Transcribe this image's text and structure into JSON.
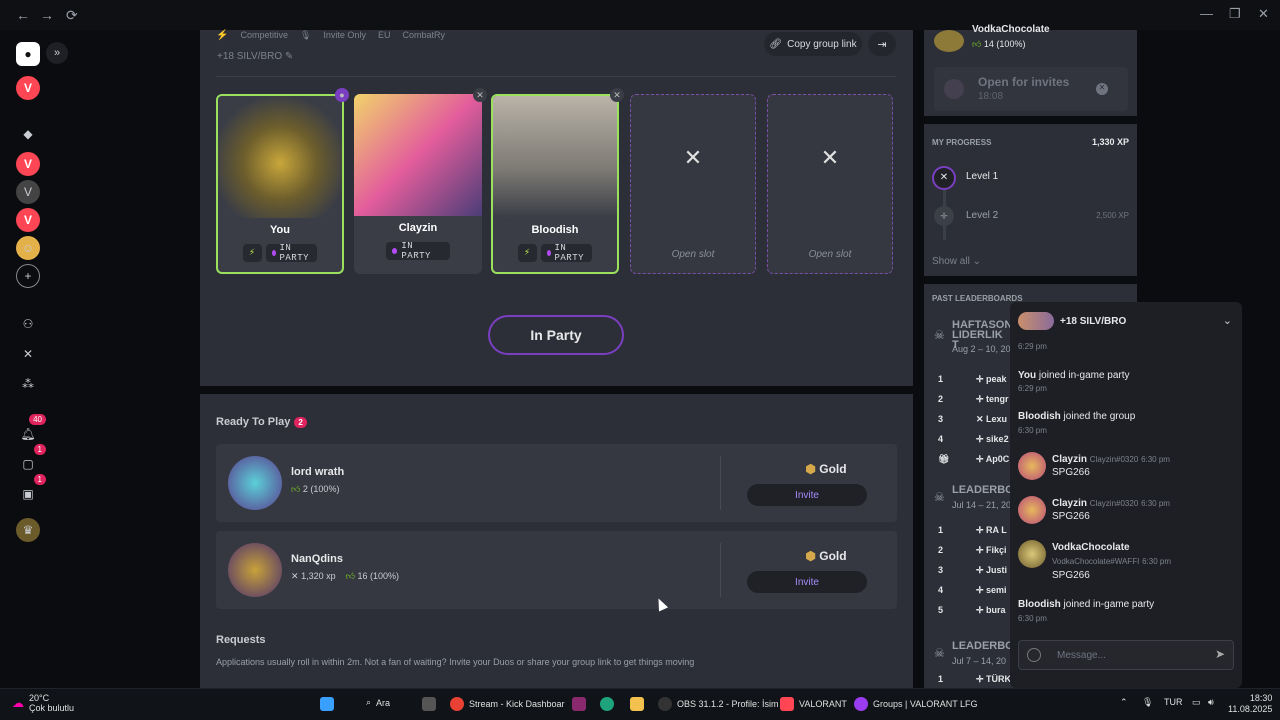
{
  "tags": [
    "Competitive",
    "Invite Only",
    "EU",
    "CombatRy"
  ],
  "group_name": "+18 SILV/BRO",
  "copy_link_label": "Copy group link",
  "members": [
    {
      "name": "You",
      "status": "IN PARTY"
    },
    {
      "name": "Clayzin",
      "status": "IN PARTY"
    },
    {
      "name": "Bloodish",
      "status": "IN PARTY"
    }
  ],
  "open_slot_label": "Open slot",
  "in_party_label": "In Party",
  "ready": {
    "title": "Ready To Play",
    "count": "2",
    "players": [
      {
        "name": "lord wrath",
        "xp": "",
        "likes": "2 (100%)",
        "rank": "Gold",
        "invite": "Invite"
      },
      {
        "name": "NanQdins",
        "xp": "1,320 xp",
        "likes": "16 (100%)",
        "rank": "Gold",
        "invite": "Invite"
      }
    ]
  },
  "requests": {
    "title": "Requests",
    "text": "Applications usually roll in within 2m. Not a fan of waiting? Invite your Duos or share your group link to get things moving"
  },
  "right": {
    "top_user": "VodkaChocolate",
    "top_likes": "14 (100%)",
    "open_invites": "Open for invites",
    "open_invites_time": "18:08",
    "progress_title": "MY PROGRESS",
    "progress_xp": "1,330 XP",
    "level1": "Level 1",
    "level2": "Level 2",
    "level2_xp": "2,500 XP",
    "show_all": "Show all",
    "past_title": "PAST LEADERBOARDS",
    "lb1_title": "HAFTASON LIDERLIK T",
    "lb1_date": "Aug 2 – 10, 20",
    "lb1_rows": [
      "peak",
      "tengr",
      "Lexu",
      "sike2",
      "Ap0C"
    ],
    "lb2_title": "LEADERBO",
    "lb2_date": "Jul 14 – 21, 20",
    "lb2_rows": [
      "RA L",
      "Fikçi",
      "Justi",
      "semi",
      "bura"
    ],
    "lb3_title": "LEADERBO",
    "lb3_date": "Jul 7 – 14, 20",
    "lb3_rows": [
      "TÜRK"
    ]
  },
  "chat": {
    "title": "+18 SILV/BRO",
    "t1": "6:29 pm",
    "m1_bold": "You",
    "m1_rest": " joined in-game party",
    "t2": "6:29 pm",
    "m2_bold": "Bloodish",
    "m2_rest": " joined the group",
    "t3": "6:30 pm",
    "c1_name": "Clayzin",
    "c1_tag": "Clayzin#0320",
    "c1_time": "6:30 pm",
    "c1_text": "SPG266",
    "c2_name": "Clayzin",
    "c2_tag": "Clayzin#0320",
    "c2_time": "6:30 pm",
    "c2_text": "SPG266",
    "c3_name": "VodkaChocolate",
    "c3_tag": "VodkaChocolate#WAFFI",
    "c3_time": "6:30 pm",
    "c3_text": "SPG266",
    "m3_bold": "Bloodish",
    "m3_rest": " joined in-game party",
    "t4": "6:30 pm",
    "placeholder": "Message..."
  },
  "rail_badges": [
    "40",
    "1",
    "1"
  ],
  "taskbar": {
    "weather_temp": "20°C",
    "weather_desc": "Çok bulutlu",
    "search": "Ara",
    "apps": [
      "Stream - Kick Dashboar",
      "OBS 31.1.2 - Profile: İsim",
      "VALORANT",
      "Groups | VALORANT LFG"
    ],
    "lang": "TUR",
    "time": "18:30",
    "date": "11.08.2025"
  }
}
